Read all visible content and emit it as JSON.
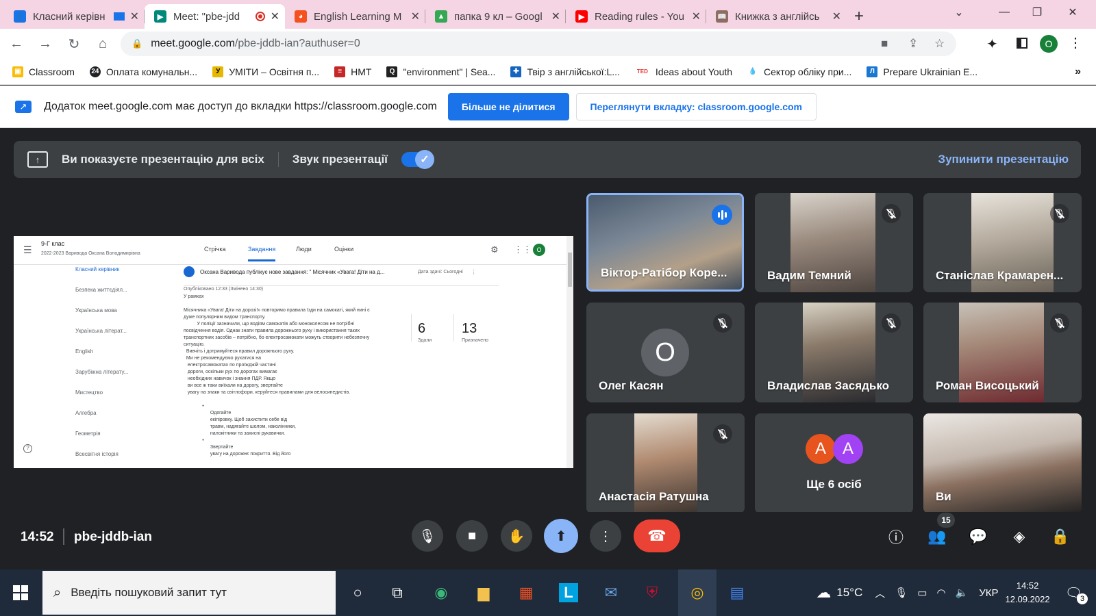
{
  "browser": {
    "tabs": [
      {
        "title": "Класний керівн",
        "fav_color": "#1a73e8",
        "fav": "👤"
      },
      {
        "title": "Meet: \"pbe-jdd",
        "fav_color": "#00897b",
        "fav": "▶",
        "active": true
      },
      {
        "title": "English Learning M",
        "fav_color": "#f4511e",
        "fav": "◕"
      },
      {
        "title": "папка 9 кл – Googl",
        "fav_color": "#34a853",
        "fav": "▲"
      },
      {
        "title": "Reading rules - You",
        "fav_color": "#ff0000",
        "fav": "▶"
      },
      {
        "title": "Книжка з англійсь",
        "fav_color": "#8d6e63",
        "fav": "📖"
      }
    ],
    "url_host": "meet.google.com",
    "url_path": "/pbe-jddb-ian?authuser=0",
    "profile_initial": "O",
    "bookmarks": [
      {
        "label": "Classroom",
        "color": "#fbbc04",
        "icon": "▣"
      },
      {
        "label": "Оплата комунальн...",
        "color": "#202124",
        "icon": "24"
      },
      {
        "label": "УМІТИ – Освітня п...",
        "color": "#e6b800",
        "icon": "У"
      },
      {
        "label": "НМТ",
        "color": "#c62828",
        "icon": "≡"
      },
      {
        "label": "\"environment\" | Sea...",
        "color": "#212121",
        "icon": "Q"
      },
      {
        "label": "Твір з англійської:L...",
        "color": "#1565c0",
        "icon": "✚"
      },
      {
        "label": "Ideas about Youth",
        "color": "#e53935",
        "icon": "TED"
      },
      {
        "label": "Сектор обліку при...",
        "color": "#42a5f5",
        "icon": "💧"
      },
      {
        "label": "Prepare Ukrainian E...",
        "color": "#1976d2",
        "icon": "Л"
      }
    ]
  },
  "share_notice": {
    "text": "Додаток meet.google.com має доступ до вкладки https://classroom.google.com",
    "stop_label": "Більше не ділитися",
    "view_label": "Переглянути вкладку: classroom.google.com"
  },
  "presentation_bar": {
    "status": "Ви показуєте презентацію для всіх",
    "audio_label": "Звук презентації",
    "stop_label": "Зупинити презентацію"
  },
  "classroom": {
    "class_name": "9-Г клас",
    "class_sub": "2022-2023 Варивода Оксана Володимирівна",
    "tabs": [
      "Стрічка",
      "Завдання",
      "Люди",
      "Оцінки"
    ],
    "sidebar": [
      "Класний керівник",
      "Безпека життєдіял...",
      "Українська мова",
      "Українська літерат...",
      "English",
      "Зарубіжна літерату...",
      "Мистецтво",
      "Алгебра",
      "Геометрія",
      "Всесвітня історія"
    ],
    "post_header": "Оксана Варивода публікує нове завдання: \" Місячник «Увага! Діти на д...",
    "post_due": "Дата здачі: Сьогодні",
    "posted": "Опубліковано 12:33 (Змінено 14:30)",
    "body_lines": [
      "У рамках",
      "",
      "Місячника «Увага! Діти на дорозі!» повторимо правила їзди на самокаті, який нині є",
      "дуже популярним видом транспорту.",
      "          У поліції зазначили, що водіям самокатів або моноколесом не потрібні",
      "посвідчення водія. Однак знати правила дорожнього руху і використання таких",
      "транспортних засобів – потрібно, бо електросамокати можуть створити небезпечну",
      "ситуацію.",
      "  Вивчіть і дотримуйтеся правил дорожнього руху.",
      "  Ми не рекомендуємо рухатися на",
      "   електросамокатах по проїжджій частині",
      "   дороги, оскільки рух по дорогах вимагає",
      "   необхідних навичок і знання ПДР. Якщо",
      "   ви все ж таки виїхали на дорогу, звертайте",
      "   увагу на знаки та світлофори, керуйтеся правилами для велосипедистів.",
      "",
      "              •",
      "                    Одягайте",
      "                    екіпіровку. Щоб захистити себе від",
      "                    травм, надягайте шолом, наколінники,",
      "                    налокітники та захисні рукавички.",
      "              •",
      "                    Звертайте",
      "                    увагу на дорожнє покриття. Від його"
    ],
    "stat_done": "6",
    "stat_done_label": "Здали",
    "stat_assigned": "13",
    "stat_assigned_label": "Призначено",
    "user_initial": "О"
  },
  "participants": [
    {
      "name": "Віктор-Ратібор Коре...",
      "speaking": true,
      "bg": "#6b7a8a"
    },
    {
      "name": "Вадим Темний",
      "bg": "#8a7e76"
    },
    {
      "name": "Станіслав Крамарен...",
      "bg": "#b8b2a8"
    },
    {
      "name": "Олег Касян",
      "initial": "О"
    },
    {
      "name": "Владислав Засядько",
      "bg": "#6d6258"
    },
    {
      "name": "Роман Висоцький",
      "bg": "#7d5048"
    },
    {
      "name": "Анастасія Ратушна",
      "bg": "#8b7868"
    },
    {
      "name": "Ще 6 осіб",
      "avatars": [
        "A",
        "A"
      ],
      "avatar_colors": [
        "#e8541e",
        "#a142f4"
      ]
    },
    {
      "name": "Ви",
      "bg": "#a49c94"
    }
  ],
  "meeting": {
    "time": "14:52",
    "code": "pbe-jddb-ian",
    "people_count": "15"
  },
  "taskbar": {
    "search_placeholder": "Введіть пошуковий запит тут",
    "temp": "15°C",
    "lang": "УКР",
    "time": "14:52",
    "date": "12.09.2022",
    "notif": "3"
  }
}
